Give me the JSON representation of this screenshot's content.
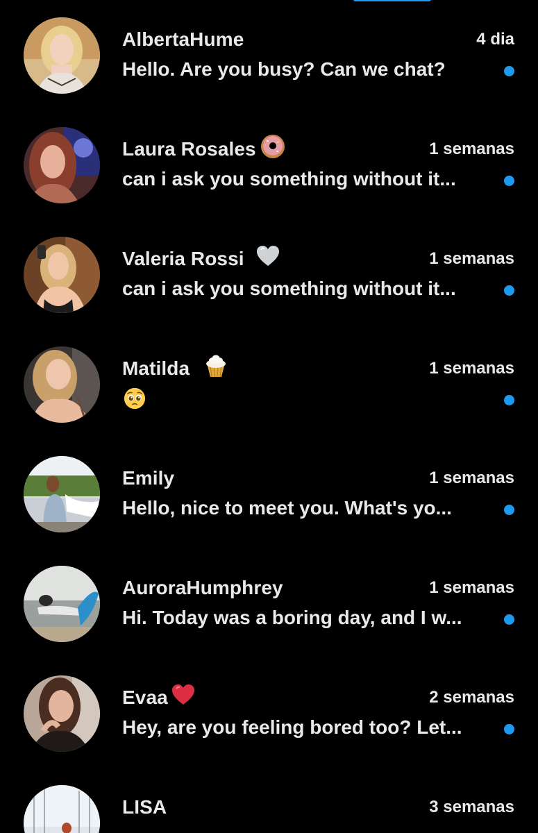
{
  "colors": {
    "background": "#000000",
    "text": "#e7e9ea",
    "unread_dot": "#1d9bf0"
  },
  "conversations": [
    {
      "name": "AlbertaHume",
      "name_emoji": "",
      "time": "4 dia",
      "preview": "Hello. Are you busy? Can we chat?",
      "unread": true
    },
    {
      "name": "Laura Rosales",
      "name_emoji": "donut-icon",
      "time": "1 semanas",
      "preview": "can i ask you something without it...",
      "unread": true
    },
    {
      "name": "Valeria Rossi",
      "name_emoji": "white-heart-icon",
      "time": "1 semanas",
      "preview": "can i ask you something without it...",
      "unread": true
    },
    {
      "name": "Matilda",
      "name_emoji": "cupcake-icon",
      "time": "1 semanas",
      "preview": "",
      "preview_emoji": "pleading-face-icon",
      "unread": true
    },
    {
      "name": "Emily",
      "name_emoji": "",
      "time": "1 semanas",
      "preview": "Hello, nice to meet you. What's yo...",
      "unread": true
    },
    {
      "name": "AuroraHumphrey",
      "name_emoji": "",
      "time": "1 semanas",
      "preview": "Hi. Today was a boring day, and I w...",
      "unread": true
    },
    {
      "name": "Evaa",
      "name_emoji": "red-heart-icon",
      "time": "2 semanas",
      "preview": "Hey, are you feeling bored too? Let...",
      "unread": true
    },
    {
      "name": "LISA",
      "name_emoji": "",
      "time": "3 semanas",
      "preview": "",
      "unread": false
    }
  ]
}
